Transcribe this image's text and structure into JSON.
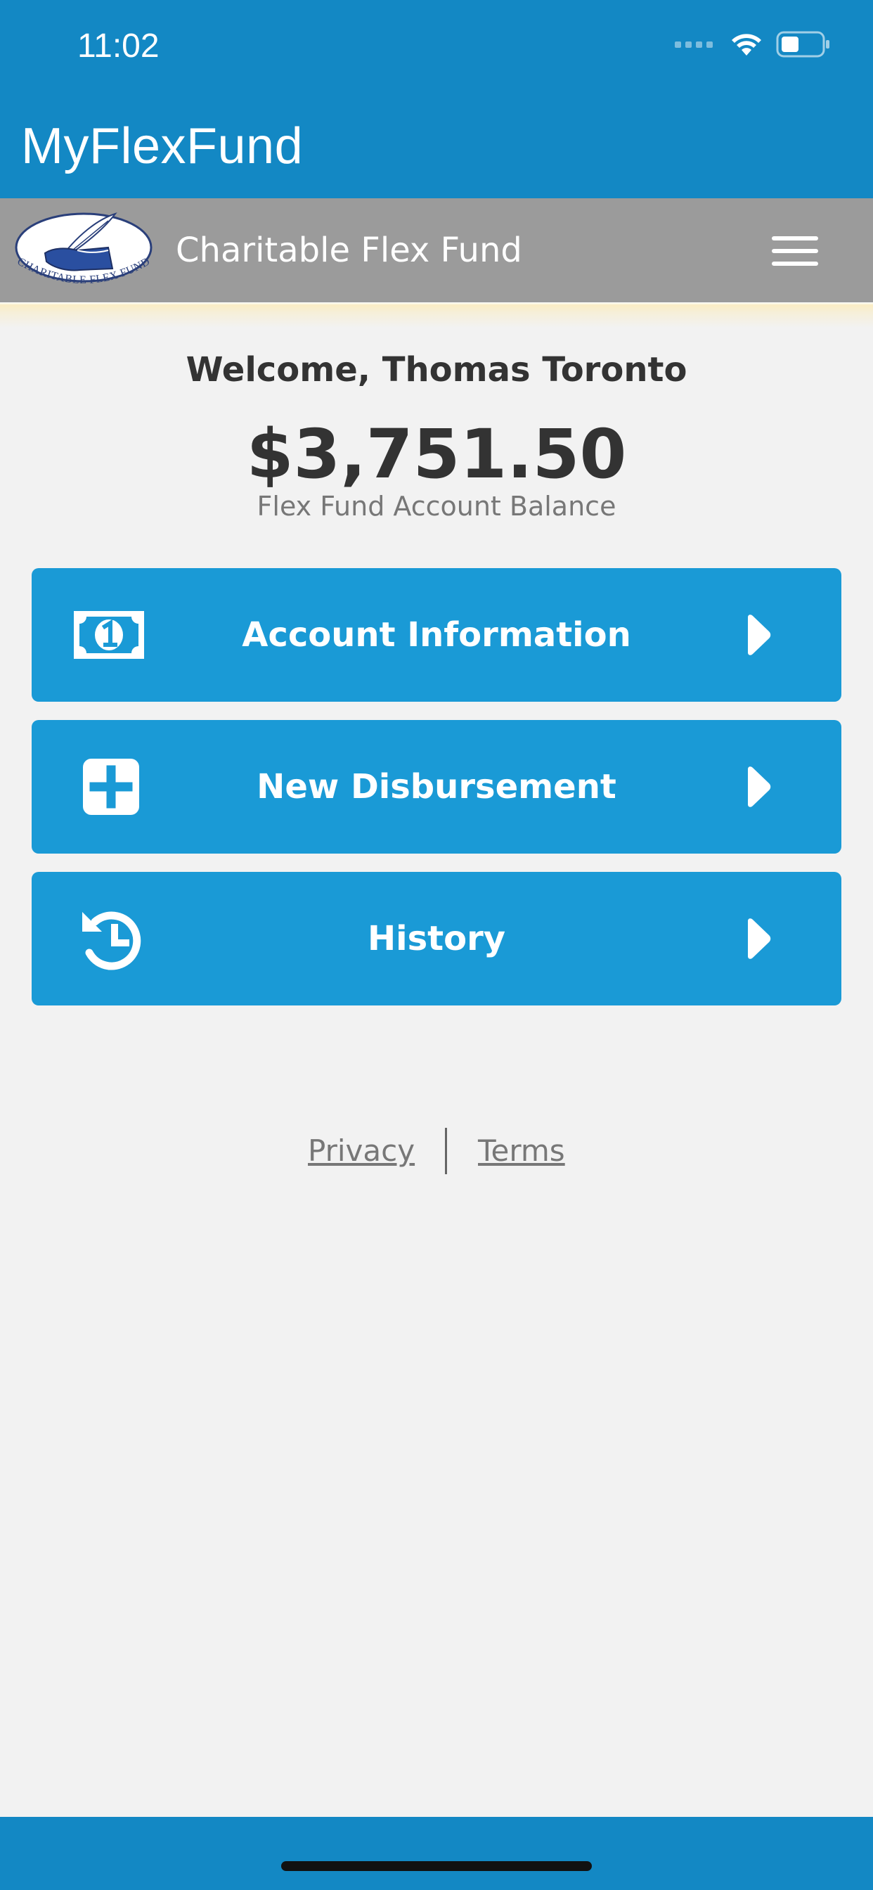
{
  "status_bar": {
    "time": "11:02",
    "icons": [
      "cellular-signal-icon",
      "wifi-icon",
      "battery-icon"
    ]
  },
  "app_bar": {
    "title": "MyFlexFund"
  },
  "brand_bar": {
    "logo_text": "CHARITABLE FLEX FUND",
    "name": "Charitable Flex Fund",
    "menu_icon": "hamburger-menu-icon"
  },
  "main": {
    "welcome": "Welcome, Thomas Toronto",
    "balance": "$3,751.50",
    "balance_label": "Flex Fund Account Balance",
    "actions": [
      {
        "label": "Account Information",
        "icon": "money-bill-icon"
      },
      {
        "label": "New Disbursement",
        "icon": "plus-square-icon"
      },
      {
        "label": "History",
        "icon": "history-clock-icon"
      }
    ]
  },
  "footer": {
    "privacy": "Privacy",
    "terms": "Terms"
  },
  "colors": {
    "primary_blue": "#1388c4",
    "button_blue": "#1a9ad6",
    "brand_gray": "#9b9b9b",
    "background": "#f2f2f2",
    "text_dark": "#333333",
    "text_muted": "#777777"
  }
}
